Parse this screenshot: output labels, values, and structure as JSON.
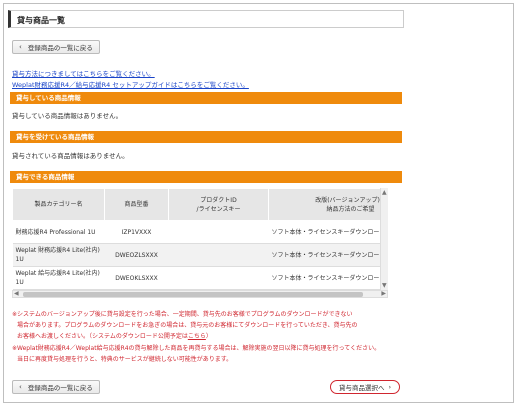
{
  "page_title": "貸与商品一覧",
  "back_label": "登録商品の一覧に戻る",
  "links": {
    "howto": "貸与方法につきましてはこちらをご覧ください。",
    "setup": "Weplat財務応援R4／給与応援R4 セットアップガイドはこちらをご覧ください。"
  },
  "sections": {
    "lending": {
      "title": "貸与している商品情報",
      "text": "貸与している商品情報はありません。"
    },
    "received": {
      "title": "貸与を受けている商品情報",
      "text": "貸与されている商品情報はありません。"
    },
    "available": {
      "title": "貸与できる商品情報"
    }
  },
  "table": {
    "headers": [
      "製品カテゴリー名",
      "商品型番",
      "プロダクトID\n/ライセンスキー",
      "改版(バージョンアップ)時\n納品方法のご希望"
    ],
    "rows": [
      [
        "財務応援R4 Professional 1U",
        "IZP1VXXX",
        "",
        "ソフト本体・ライセンスキーダウンロード希"
      ],
      [
        "Weplat 財務応援R4 Lite(社内) 1U",
        "DWEOZLSXXX",
        "",
        "ソフト本体・ライセンスキーダウンロード希"
      ],
      [
        "Weplat 給与応援R4 Lite(社内) 1U",
        "DWEOKLSXXX",
        "",
        "ソフト本体・ライセンスキーダウンロード希"
      ]
    ]
  },
  "notes": {
    "line1": "※システムのバージョンアップ後に貸与設定を行った場合、一定期間、貸与先のお客様でプログラムのダウンロードができない",
    "line2": "場合があります。プログラムのダウンロードをお急ぎの場合は、貸与元のお客様にてダウンロードを行っていただき、貸与先の",
    "line3_pre": "お客様へお渡しください。（システムのダウンロード公開予定は",
    "line3_link": "こちら",
    "line3_post": "）",
    "line4": "※Weplat財務応援R4／Weplat給与応援R4の貸与解除した商品を再貸与する場合は、解除実施の翌日以降に貸与処理を行ってください。",
    "line5": "当日に再度貸与処理を行うと、特典のサービスが継続しない可能性があります。"
  },
  "next_label": "貸与商品選択へ"
}
